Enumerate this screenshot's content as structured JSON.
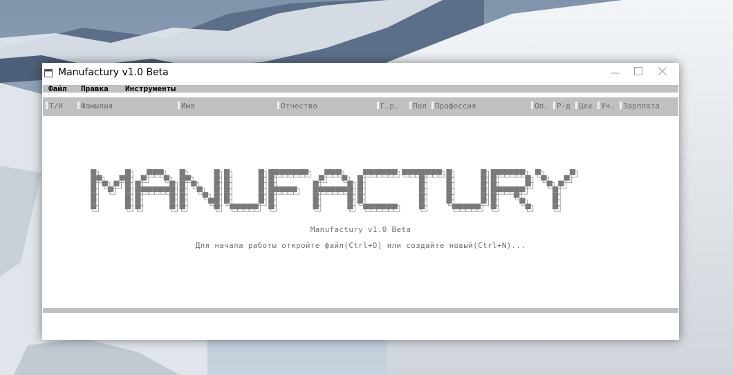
{
  "window": {
    "title": "Manufactury v1.0 Beta"
  },
  "menu": [
    {
      "label": "Файл"
    },
    {
      "label": "Правка"
    },
    {
      "label": "Инструменты"
    }
  ],
  "columns": [
    {
      "label": "Т/Н"
    },
    {
      "label": "Фамилия"
    },
    {
      "label": "Имя"
    },
    {
      "label": "Отчество"
    },
    {
      "label": "Г.р."
    },
    {
      "label": "Пол"
    },
    {
      "label": "Профессия"
    },
    {
      "label": "Оп."
    },
    {
      "label": "Р-д"
    },
    {
      "label": "Цех"
    },
    {
      "label": "Уч."
    },
    {
      "label": "Зарплата"
    }
  ],
  "splash": {
    "logo_text": "MANUFACTURY",
    "subtitle": "Manufactury v1.0 Beta",
    "hint": "Для начала работы откройте файл(Ctrl+O) или создайте новый(Ctrl+N)..."
  },
  "icons": {
    "app": "app-window-icon",
    "minimize": "minimize-icon",
    "maximize": "maximize-icon",
    "close": "close-icon"
  }
}
